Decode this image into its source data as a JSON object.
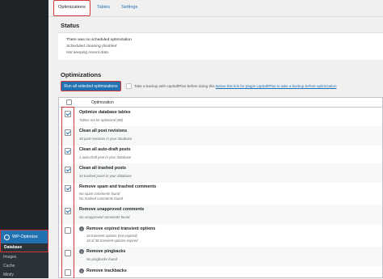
{
  "sidebar": {
    "menu_label": "WP-Optimize",
    "submenu": [
      "Database",
      "Images",
      "Cache",
      "Minify"
    ]
  },
  "tabs": [
    "Optimizations",
    "Tables",
    "Settings"
  ],
  "status": {
    "heading": "Status",
    "lines": [
      "There was no scheduled optimization",
      "Scheduled cleaning disabled",
      "Not keeping recent data"
    ]
  },
  "optimizations": {
    "heading": "Optimizations",
    "run_button": "Run all selected optimizations",
    "backup_prefix": "Take a backup with UpdraftPlus before doing this",
    "backup_link": "Below this link for plugin UpdraftPlus to take a backup before optimization",
    "column_header": "Optimization",
    "rows": [
      {
        "title": "Optimize database tables",
        "sub": "Tables not be optimized (88)",
        "checked": true
      },
      {
        "title": "Clean all post revisions",
        "sub": "48 post revisions in your database",
        "checked": true
      },
      {
        "title": "Clean all auto-draft posts",
        "sub": "1 auto-draft post in your database",
        "checked": true
      },
      {
        "title": "Clean all trashed posts",
        "sub": "10 trashed posts in your database",
        "checked": true
      },
      {
        "title": "Remove spam and trashed comments",
        "sub": "No spam comments found",
        "sub2": "No trashed comments found",
        "checked": true
      },
      {
        "title": "Remove unapproved comments",
        "sub": "No unapproved comments found",
        "checked": true
      },
      {
        "title": "Remove expired transient options",
        "sub": "16 transient options (not expired)",
        "sub2": "16 of 38 transient options expired",
        "checked": false,
        "warn": true
      },
      {
        "title": "Remove pingbacks",
        "sub": "No pingbacks found",
        "checked": false,
        "warn": true
      },
      {
        "title": "Remove trackbacks",
        "sub": "",
        "checked": false,
        "warn": true
      }
    ]
  },
  "colors": {
    "accent": "#2271b1",
    "highlight": "#d63638",
    "sidebar": "#1d2327"
  }
}
